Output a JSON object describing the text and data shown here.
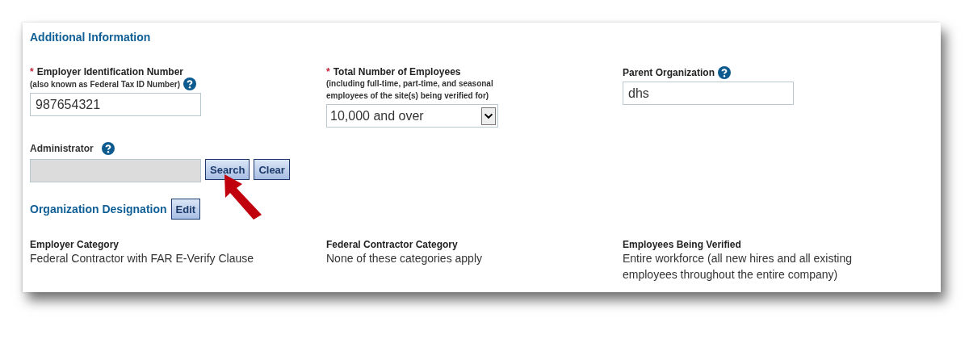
{
  "section_title": "Additional Information",
  "fields": [
    {
      "label": "Employer Identification Number",
      "required_mark": "*",
      "help": true,
      "note": "(also known as Federal Tax ID Number)",
      "kind": "text",
      "value": "987654321"
    },
    {
      "label": "Total Number of Employees",
      "required_mark": "*",
      "help": false,
      "note": "(including full-time, part-time, and seasonal employees of the site(s) being verified for)",
      "kind": "select",
      "value": "10,000 and over"
    },
    {
      "label": "Parent Organization",
      "help": true,
      "kind": "text",
      "value": "dhs"
    }
  ],
  "administrator": {
    "label": "Administrator",
    "help": true,
    "disabled": true,
    "buttons": [
      "Search",
      "Clear"
    ]
  },
  "designation": {
    "title": "Organization Designation",
    "button": "Edit",
    "items": [
      {
        "label": "Employer Category",
        "value": "Federal Contractor with FAR E-Verify Clause"
      },
      {
        "label": "Federal Contractor Category",
        "value": "None of these categories apply"
      },
      {
        "label": "Employees Being Verified",
        "value": "Entire workforce (all new hires and all existing employees throughout the entire company)"
      }
    ]
  }
}
